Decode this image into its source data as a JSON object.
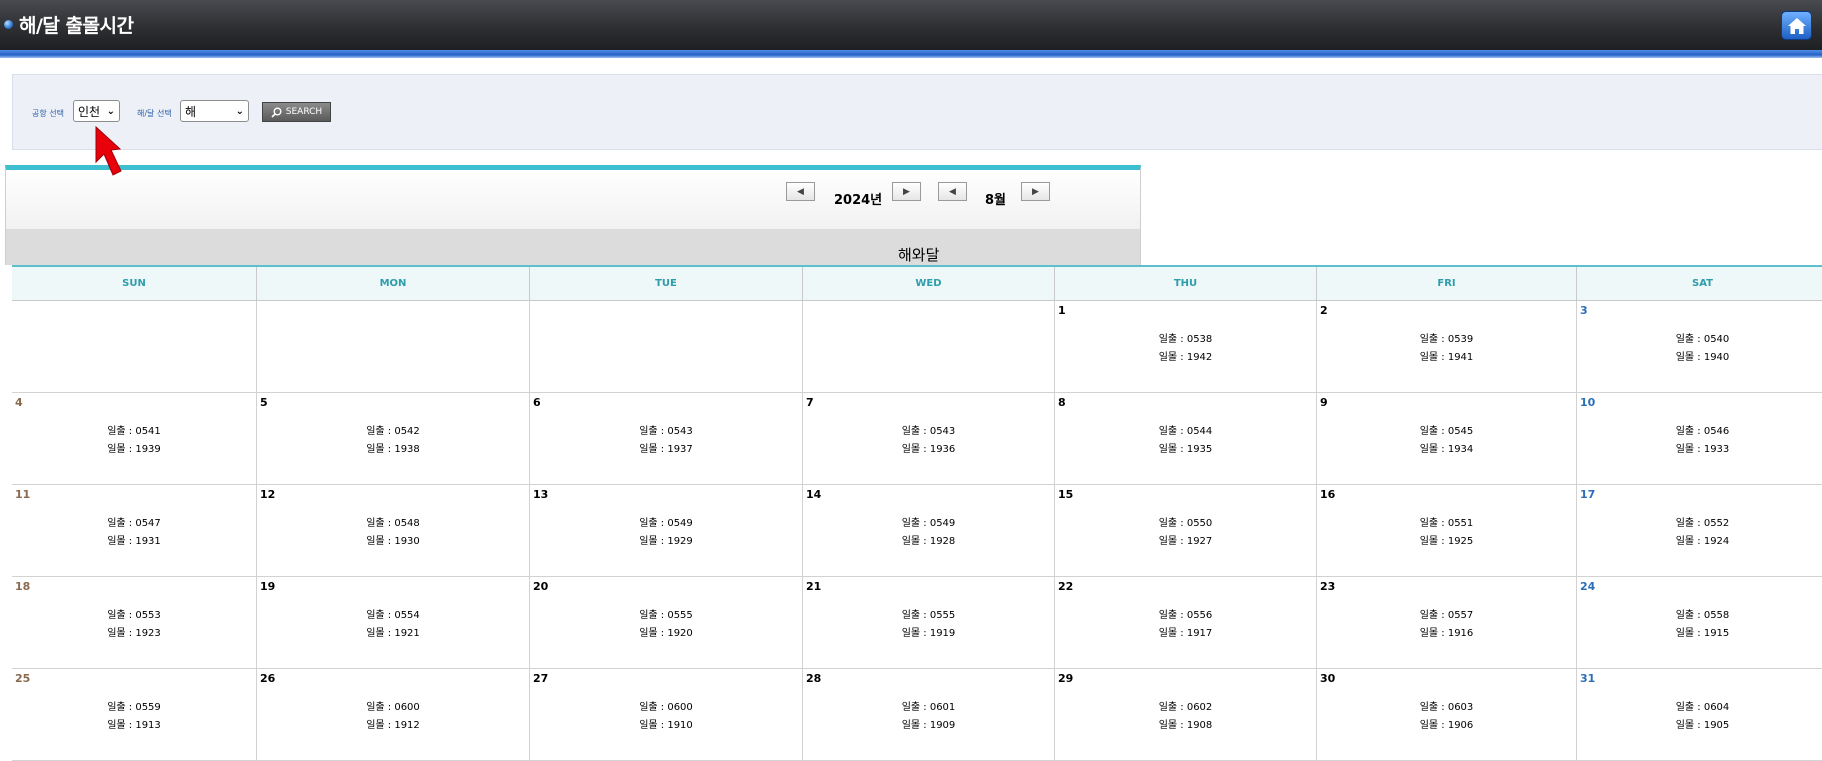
{
  "header": {
    "title": "해/달 출몰시간"
  },
  "search": {
    "airport_label": "공항 선택",
    "airport_value": "인천",
    "type_label": "해/달 선택",
    "type_value": "해",
    "button_label": "SEARCH"
  },
  "nav": {
    "year": "2024년",
    "month": "8월"
  },
  "subheader": "해와달",
  "weekdays": [
    "SUN",
    "MON",
    "TUE",
    "WED",
    "THU",
    "FRI",
    "SAT"
  ],
  "weeks": [
    [
      null,
      null,
      null,
      null,
      {
        "day": "1",
        "rise": "일출 : 0538",
        "set": "일몰 : 1942"
      },
      {
        "day": "2",
        "rise": "일출 : 0539",
        "set": "일몰 : 1941"
      },
      {
        "day": "3",
        "rise": "일출 : 0540",
        "set": "일몰 : 1940"
      }
    ],
    [
      {
        "day": "4",
        "rise": "일출 : 0541",
        "set": "일몰 : 1939"
      },
      {
        "day": "5",
        "rise": "일출 : 0542",
        "set": "일몰 : 1938"
      },
      {
        "day": "6",
        "rise": "일출 : 0543",
        "set": "일몰 : 1937"
      },
      {
        "day": "7",
        "rise": "일출 : 0543",
        "set": "일몰 : 1936"
      },
      {
        "day": "8",
        "rise": "일출 : 0544",
        "set": "일몰 : 1935"
      },
      {
        "day": "9",
        "rise": "일출 : 0545",
        "set": "일몰 : 1934"
      },
      {
        "day": "10",
        "rise": "일출 : 0546",
        "set": "일몰 : 1933"
      }
    ],
    [
      {
        "day": "11",
        "rise": "일출 : 0547",
        "set": "일몰 : 1931"
      },
      {
        "day": "12",
        "rise": "일출 : 0548",
        "set": "일몰 : 1930"
      },
      {
        "day": "13",
        "rise": "일출 : 0549",
        "set": "일몰 : 1929"
      },
      {
        "day": "14",
        "rise": "일출 : 0549",
        "set": "일몰 : 1928"
      },
      {
        "day": "15",
        "rise": "일출 : 0550",
        "set": "일몰 : 1927"
      },
      {
        "day": "16",
        "rise": "일출 : 0551",
        "set": "일몰 : 1925"
      },
      {
        "day": "17",
        "rise": "일출 : 0552",
        "set": "일몰 : 1924"
      }
    ],
    [
      {
        "day": "18",
        "rise": "일출 : 0553",
        "set": "일몰 : 1923"
      },
      {
        "day": "19",
        "rise": "일출 : 0554",
        "set": "일몰 : 1921"
      },
      {
        "day": "20",
        "rise": "일출 : 0555",
        "set": "일몰 : 1920"
      },
      {
        "day": "21",
        "rise": "일출 : 0555",
        "set": "일몰 : 1919"
      },
      {
        "day": "22",
        "rise": "일출 : 0556",
        "set": "일몰 : 1917"
      },
      {
        "day": "23",
        "rise": "일출 : 0557",
        "set": "일몰 : 1916"
      },
      {
        "day": "24",
        "rise": "일출 : 0558",
        "set": "일몰 : 1915"
      }
    ],
    [
      {
        "day": "25",
        "rise": "일출 : 0559",
        "set": "일몰 : 1913"
      },
      {
        "day": "26",
        "rise": "일출 : 0600",
        "set": "일몰 : 1912"
      },
      {
        "day": "27",
        "rise": "일출 : 0600",
        "set": "일몰 : 1910"
      },
      {
        "day": "28",
        "rise": "일출 : 0601",
        "set": "일몰 : 1909"
      },
      {
        "day": "29",
        "rise": "일출 : 0602",
        "set": "일몰 : 1908"
      },
      {
        "day": "30",
        "rise": "일출 : 0603",
        "set": "일몰 : 1906"
      },
      {
        "day": "31",
        "rise": "일출 : 0604",
        "set": "일몰 : 1905"
      }
    ]
  ],
  "colors": {
    "accent_cyan": "#3dbfd0",
    "header_text": "#2d9cab",
    "sunday": "#8a6a4e",
    "saturday": "#2d6fb7",
    "pointer": "#e8000b"
  },
  "icons": {
    "home": "home-icon",
    "search": "search-icon",
    "prev": "triangle-left-icon",
    "next": "triangle-right-icon",
    "select": "chevron-down-icon",
    "cursor": "red-pointer-arrow"
  }
}
